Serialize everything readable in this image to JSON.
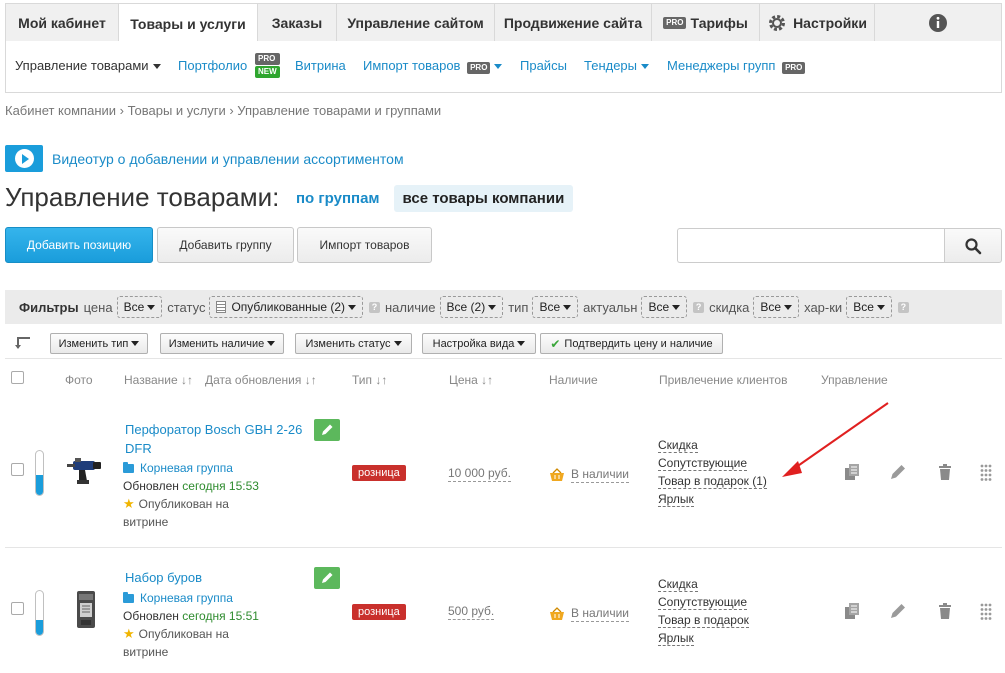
{
  "top_tabs": [
    {
      "label": "Мой кабинет"
    },
    {
      "label": "Товары и услуги"
    },
    {
      "label": "Заказы"
    },
    {
      "label": "Управление сайтом"
    },
    {
      "label": "Продвижение сайта"
    },
    {
      "label": "Тарифы",
      "badge": "PRO"
    },
    {
      "label": "Настройки"
    },
    {
      "label": "",
      "icon": "info-icon"
    }
  ],
  "sub_nav": {
    "manage_products": "Управление товарами",
    "portfolio": "Портфолио",
    "portfolio_badge_pro": "PRO",
    "portfolio_badge_new": "NEW",
    "showcase": "Витрина",
    "import": "Импорт товаров",
    "import_badge": "PRO",
    "pricelists": "Прайсы",
    "tenders": "Тендеры",
    "group_managers": "Менеджеры групп",
    "group_managers_badge": "PRO"
  },
  "breadcrumb": "Кабинет компании › Товары и услуги › Управление товарами и группами",
  "video_link": "Видеотур о добавлении и управлении ассортиментом",
  "page_title": "Управление товарами:",
  "view_toggle": {
    "by_groups": "по группам",
    "all_products": "все товары компании"
  },
  "buttons": {
    "add_position": "Добавить позицию",
    "add_group": "Добавить группу",
    "import": "Импорт товаров"
  },
  "search": {
    "placeholder": "",
    "value": ""
  },
  "filters": {
    "title": "Фильтры",
    "price_label": "цена",
    "price_value": "Все",
    "status_label": "статус",
    "status_value": "Опубликованные (2)",
    "availability_label": "наличие",
    "availability_value": "Все (2)",
    "type_label": "тип",
    "type_value": "Все",
    "actual_label": "актуальн",
    "actual_value": "Все",
    "discount_label": "скидка",
    "discount_value": "Все",
    "chars_label": "хар-ки",
    "chars_value": "Все",
    "help": "?"
  },
  "actions": {
    "change_type": "Изменить тип",
    "change_availability": "Изменить наличие",
    "change_status": "Изменить статус",
    "view_settings": "Настройка вида",
    "confirm": "Подтвердить цену и наличие"
  },
  "columns": {
    "photo": "Фото",
    "name": "Название ↓↑",
    "updated": "Дата обновления ↓↑",
    "type": "Тип ↓↑",
    "price": "Цена ↓↑",
    "availability": "Наличие",
    "promo": "Привлечение клиентов",
    "management": "Управление"
  },
  "products": [
    {
      "name_line1": "Перфоратор Bosch GBH 2-26",
      "name_line2": "DFR",
      "group": "Корневая группа",
      "updated_prefix": "Обновлен",
      "updated_value": "сегодня 15:53",
      "published": "Опубликован на витрине",
      "type": "розница",
      "price": "10 000 руб.",
      "availability": "В наличии",
      "promo": [
        "Скидка",
        "Сопутствующие",
        "Товар в подарок (1)",
        "Ярлык"
      ],
      "fill_level": 0.45
    },
    {
      "name_line1": "Набор буров",
      "name_line2": "",
      "group": "Корневая группа",
      "updated_prefix": "Обновлен",
      "updated_value": "сегодня 15:51",
      "published": "Опубликован на витрине",
      "type": "розница",
      "price": "500 руб.",
      "availability": "В наличии",
      "promo": [
        "Скидка",
        "Сопутствующие",
        "Товар в подарок",
        "Ярлык"
      ],
      "fill_level": 0.35
    }
  ],
  "colors": {
    "accent": "#1a9ddb",
    "link": "#1a8bc8",
    "badge_red": "#c9302c",
    "edit_green": "#5cb85c",
    "arrow_red": "#e02020"
  }
}
